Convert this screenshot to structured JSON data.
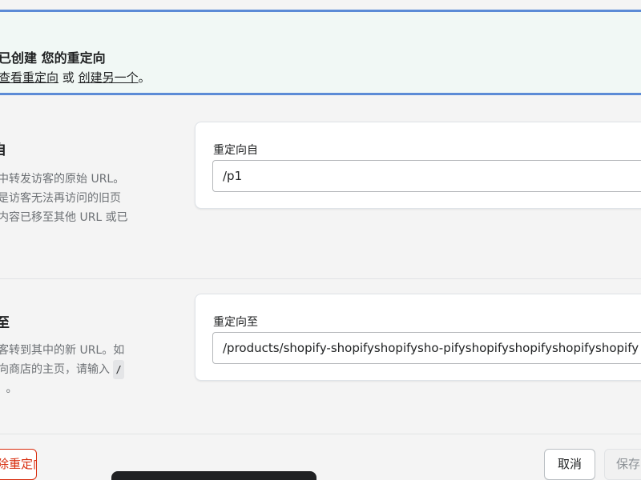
{
  "banner": {
    "title": "已创建 您的重定向",
    "view_link": "查看重定向",
    "or_text": " 或 ",
    "create_link": "创建另一个",
    "end_punct": "。",
    "colors": {
      "background": "#f1f8f5",
      "border": "#5c8bd6"
    }
  },
  "from_section": {
    "title": "自",
    "desc_lines": [
      "中转发访客的原始 URL。",
      "是访客无法再访问的旧页",
      "内容已移至其他 URL 或已"
    ],
    "field_label": "重定向自",
    "field_value": "/p1"
  },
  "to_section": {
    "title": "至",
    "desc_line1": "客转到其中的新 URL。如",
    "desc_line2": "向商店的主页，请输入",
    "desc_code": "/",
    "desc_line3_code": " ",
    "desc_line3_end": "。",
    "field_label": "重定向至",
    "field_value": "/products/shopify-shopifyshopifysho-pifyshopifyshopifyshopifyshopify"
  },
  "actions": {
    "delete_label": "删除重定向",
    "cancel_label": "取消",
    "save_label": "保存",
    "colors": {
      "danger": "#d72c0d"
    }
  }
}
